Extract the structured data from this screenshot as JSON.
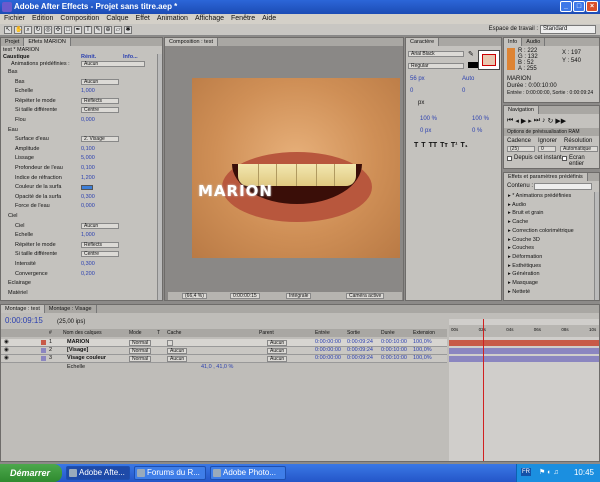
{
  "window": {
    "title": "Adobe After Effects - Projet sans titre.aep *"
  },
  "menu": [
    "Fichier",
    "Edition",
    "Composition",
    "Calque",
    "Effet",
    "Animation",
    "Affichage",
    "Fenêtre",
    "Aide"
  ],
  "workspace": {
    "label": "Espace de travail :",
    "value": "Standard"
  },
  "effects_panel": {
    "tabs": [
      "Projet",
      "Effets MARION"
    ],
    "header": "test * MARION",
    "effect_name": "Caustique",
    "reset": "Rénit.",
    "info": "Info...",
    "presets_label": "Animations prédéfinies :",
    "presets_value": "Aucun",
    "rows": [
      {
        "label": "Bas",
        "value": "",
        "indent": 1,
        "kind": "group"
      },
      {
        "label": "Bas",
        "value": "Aucun",
        "indent": 2,
        "kind": "drop"
      },
      {
        "label": "Echelle",
        "value": "1,000",
        "indent": 2,
        "kind": "val"
      },
      {
        "label": "Répéter le mode",
        "value": "Reflects",
        "indent": 2,
        "kind": "drop"
      },
      {
        "label": "Si taille différente",
        "value": "Centre",
        "indent": 2,
        "kind": "drop"
      },
      {
        "label": "Flou",
        "value": "0,000",
        "indent": 2,
        "kind": "val"
      },
      {
        "label": "Eau",
        "value": "",
        "indent": 1,
        "kind": "group"
      },
      {
        "label": "Surface d'eau",
        "value": "2. Visage",
        "indent": 2,
        "kind": "drop"
      },
      {
        "label": "Amplitude",
        "value": "0,100",
        "indent": 2,
        "kind": "val"
      },
      {
        "label": "Lissage",
        "value": "5,000",
        "indent": 2,
        "kind": "val"
      },
      {
        "label": "Profondeur de l'eau",
        "value": "0,100",
        "indent": 2,
        "kind": "val"
      },
      {
        "label": "Indice de réfraction",
        "value": "1,200",
        "indent": 2,
        "kind": "val"
      },
      {
        "label": "Couleur de la surfa",
        "value": "",
        "indent": 2,
        "kind": "swatch"
      },
      {
        "label": "Opacité de la surfa",
        "value": "0,300",
        "indent": 2,
        "kind": "val"
      },
      {
        "label": "Force de l'eau",
        "value": "0,000",
        "indent": 2,
        "kind": "val"
      },
      {
        "label": "Ciel",
        "value": "",
        "indent": 1,
        "kind": "group"
      },
      {
        "label": "Ciel",
        "value": "Aucun",
        "indent": 2,
        "kind": "drop"
      },
      {
        "label": "Echelle",
        "value": "1,000",
        "indent": 2,
        "kind": "val"
      },
      {
        "label": "Répéter le mode",
        "value": "Reflects",
        "indent": 2,
        "kind": "drop"
      },
      {
        "label": "Si taille différente",
        "value": "Centre",
        "indent": 2,
        "kind": "drop"
      },
      {
        "label": "Intensité",
        "value": "0,300",
        "indent": 2,
        "kind": "val"
      },
      {
        "label": "Convergence",
        "value": "0,200",
        "indent": 2,
        "kind": "val"
      },
      {
        "label": "Eclairage",
        "value": "",
        "indent": 1,
        "kind": "group"
      },
      {
        "label": "Matériel",
        "value": "",
        "indent": 1,
        "kind": "group"
      }
    ]
  },
  "composition": {
    "tab": "Composition : test",
    "overlay_text": "MARION",
    "zoom": "(66,4 %)",
    "timecode": "0:00:00:15",
    "resolution": "Intégrale",
    "camera": "Caméra active"
  },
  "character": {
    "tab": "Caractère",
    "font": "Arial Black",
    "style": "Regular",
    "size": "56 px",
    "leading": "Auto",
    "kerning": "0",
    "tracking": "0",
    "stroke": "px",
    "vscale": "100 %",
    "hscale": "100 %",
    "baseline": "0 px",
    "tsume": "0 %"
  },
  "info": {
    "tabs": [
      "Info",
      "Audio"
    ],
    "r": "R : 222",
    "g": "G : 132",
    "b": "B : 52",
    "a": "A : 255",
    "x": "X : 197",
    "y": "Y : 540",
    "layer": "MARION",
    "duration": "Durée : 0:00:10:00",
    "in_out": "Entrée : 0:00:00:00, Sortie : 0:00:09:24",
    "swatch": "#de8434"
  },
  "navigation": {
    "tab": "Navigation",
    "preview_tab": "Options de prévisualisation RAM",
    "cadence": "Cadence",
    "ignore": "Ignorer",
    "resolution": "Résolution",
    "cadence_val": "(25)",
    "ignore_val": "0",
    "res_val": "Automatique",
    "from_current": "Depuis cet instant",
    "fullscreen": "Ecran entier"
  },
  "effects_presets": {
    "tab": "Effets et paramètres prédéfinis",
    "contents_label": "Contenu :",
    "items": [
      "* Animations prédéfinies",
      "Audio",
      "Bruit et grain",
      "Cache",
      "Correction colorimétrique",
      "Couche 3D",
      "Couches",
      "Déformation",
      "Esthétiques",
      "Génération",
      "Masquage",
      "Netteté"
    ]
  },
  "timeline": {
    "tabs": [
      "Montage : test",
      "Montage : Visage"
    ],
    "timecode": "0:00:09:15",
    "fps": "(25,00 ips)",
    "headers": [
      "#",
      "Nom des calques",
      "Mode",
      "T",
      "Cache",
      "Parent",
      "Entrée",
      "Sortie",
      "Durée",
      "Extension"
    ],
    "ruler": [
      "00s",
      "01s",
      "02s",
      "03s",
      "04s",
      "05s",
      "06s",
      "07s",
      "08s",
      "09s",
      "10s"
    ],
    "playhead_fraction": 0.96,
    "layers": [
      {
        "num": "1",
        "name": "MARION",
        "mode": "Normal",
        "cache": "",
        "parent": "Aucun",
        "in": "0:00:00:00",
        "out": "0:00:09:24",
        "dur": "0:00:10:00",
        "ext": "100,0%",
        "color": "#c85a48"
      },
      {
        "num": "2",
        "name": "[Visage]",
        "mode": "Normal",
        "cache": "Aucun",
        "parent": "Aucun",
        "in": "0:00:00:00",
        "out": "0:00:09:24",
        "dur": "0:00:10:00",
        "ext": "100,0%",
        "color": "#8b86c0"
      },
      {
        "num": "3",
        "name": "Visage couleur",
        "mode": "Normal",
        "cache": "Aucun",
        "parent": "Aucun",
        "in": "0:00:00:00",
        "out": "0:00:09:24",
        "dur": "0:00:10:00",
        "ext": "100,0%",
        "color": "#8b86c0"
      }
    ],
    "sub_property": {
      "label": "Echelle",
      "value": "41,0 , 41,0 %"
    }
  },
  "taskbar": {
    "start": "Démarrer",
    "tasks": [
      "Adobe Afte...",
      "Forums du R...",
      "Adobe Photo..."
    ],
    "lang": "FR",
    "clock": "10:45"
  }
}
